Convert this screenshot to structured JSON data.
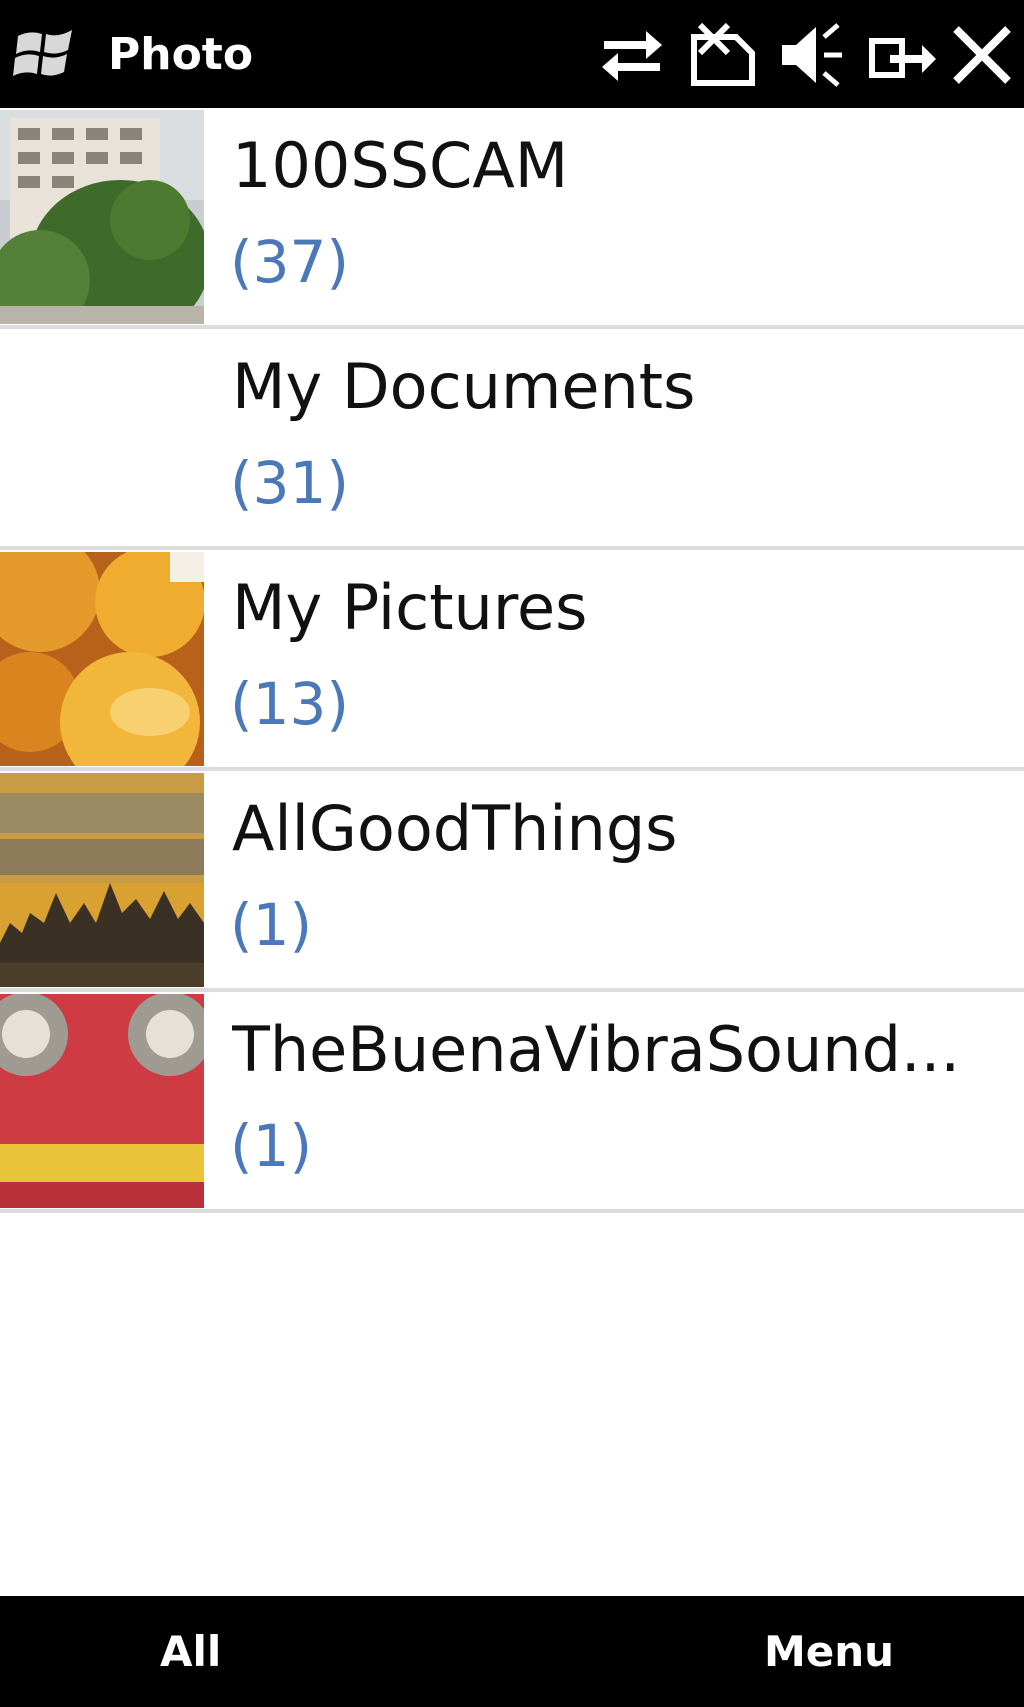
{
  "title_bar": {
    "start_icon": "windows-flag-icon",
    "app_title": "Photo",
    "status_icons": [
      "connectivity-arrows-icon",
      "no-sim-icon",
      "speaker-muted-icon",
      "signal-link-icon",
      "close-icon"
    ]
  },
  "albums": [
    {
      "name": "100SSCAM",
      "count": "(37)",
      "thumbnail": "building-trees-photo"
    },
    {
      "name": "My Documents",
      "count": "(31)",
      "thumbnail": "none"
    },
    {
      "name": "My Pictures",
      "count": "(13)",
      "thumbnail": "oranges-photo"
    },
    {
      "name": "AllGoodThings",
      "count": "(1)",
      "thumbnail": "album-cover-skyline"
    },
    {
      "name": "TheBuenaVibraSound...",
      "count": "(1)",
      "thumbnail": "album-cover-speakers"
    }
  ],
  "softkeys": {
    "left": "All",
    "right": "Menu"
  },
  "colors": {
    "bar_background": "#000000",
    "count_text": "#4a78b8",
    "separator": "#dcdcdc"
  }
}
